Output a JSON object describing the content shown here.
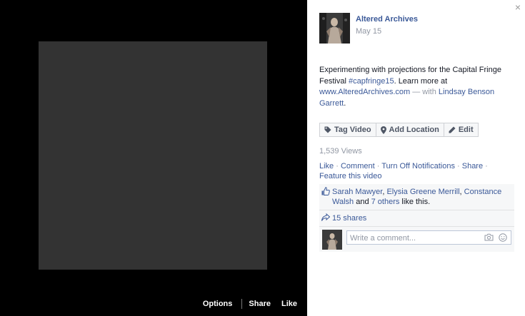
{
  "video": {
    "options_label": "Options",
    "share_label": "Share",
    "like_label": "Like"
  },
  "panel": {
    "close_glyph": "×",
    "page_name": "Altered Archives",
    "date": "May 15",
    "caption": {
      "text_1": "Experimenting with projections for the Capital Fringe Festival ",
      "hashtag": "#capfringe15",
      "text_2": ". Learn more at ",
      "url": "www.AlteredArchives.com",
      "with_text": " — with ",
      "tagged": "Lindsay Benson Garrett",
      "end": "."
    },
    "actions": {
      "tag_video": "Tag Video",
      "add_location": "Add Location",
      "edit": "Edit"
    },
    "views": "1,539 Views",
    "links": {
      "like": "Like",
      "comment": "Comment",
      "notifications": "Turn Off Notifications",
      "share": "Share",
      "feature": "Feature this video",
      "sep": " · "
    },
    "likes": {
      "name_1": "Sarah Mawyer",
      "comma": ", ",
      "name_2": "Elysia Greene Merrill",
      "name_3": "Constance Walsh",
      "and_text": " and ",
      "others": "7 others",
      "suffix": " like this."
    },
    "shares": "15 shares",
    "comment": {
      "placeholder": "Write a comment..."
    }
  },
  "colors": {
    "link": "#3b5998",
    "muted": "#9197a3",
    "theater_bg": "#000000",
    "video_bg": "#333333",
    "ufi_bg": "#f6f7f8"
  },
  "icons": [
    "close-icon",
    "tag-icon",
    "location-pin-icon",
    "pencil-icon",
    "thumbs-up-icon",
    "share-arrow-icon",
    "camera-icon",
    "emoji-icon"
  ]
}
